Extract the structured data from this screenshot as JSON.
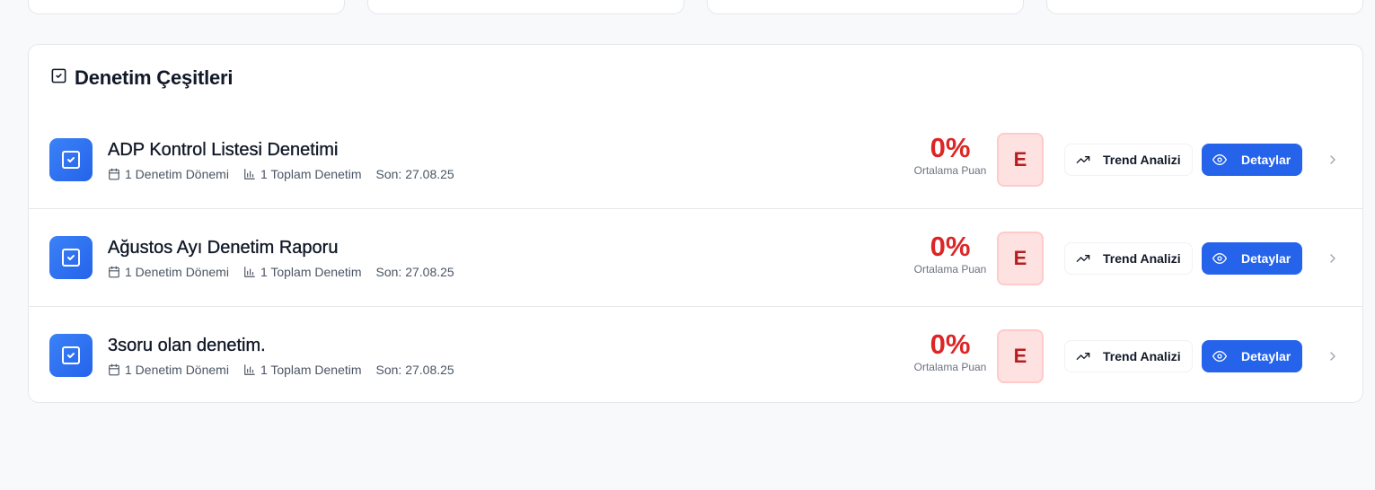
{
  "section": {
    "title": "Denetim Çeşitleri"
  },
  "colors": {
    "accent": "#2563eb",
    "score": "#dc2626",
    "grade_bg": "#fee2e2"
  },
  "rows": [
    {
      "title": "ADP Kontrol Listesi Denetimi",
      "periods": "1 Denetim Dönemi",
      "total": "1 Toplam Denetim",
      "last": "Son: 27.08.25",
      "score": "0%",
      "score_label": "Ortalama Puan",
      "grade": "E",
      "trend_label": "Trend Analizi",
      "detail_label": "Detaylar"
    },
    {
      "title": "Ağustos Ayı Denetim Raporu",
      "periods": "1 Denetim Dönemi",
      "total": "1 Toplam Denetim",
      "last": "Son: 27.08.25",
      "score": "0%",
      "score_label": "Ortalama Puan",
      "grade": "E",
      "trend_label": "Trend Analizi",
      "detail_label": "Detaylar"
    },
    {
      "title": "3soru olan denetim.",
      "periods": "1 Denetim Dönemi",
      "total": "1 Toplam Denetim",
      "last": "Son: 27.08.25",
      "score": "0%",
      "score_label": "Ortalama Puan",
      "grade": "E",
      "trend_label": "Trend Analizi",
      "detail_label": "Detaylar"
    }
  ]
}
